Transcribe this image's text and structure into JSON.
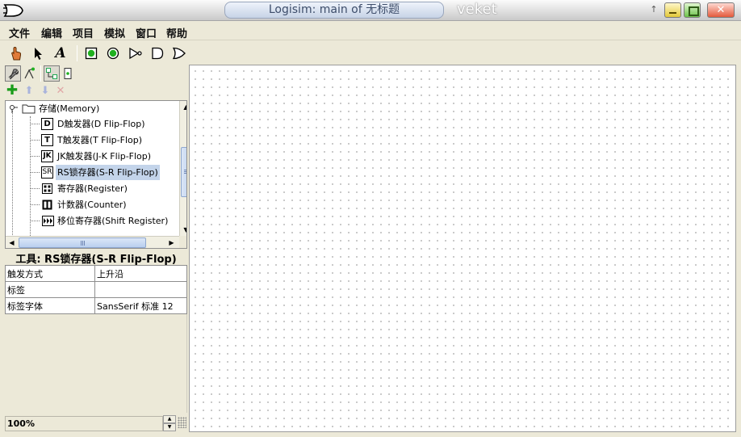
{
  "window": {
    "title": "Logisim: main of 无标题",
    "brand": "veket"
  },
  "menu": [
    "文件",
    "编辑",
    "项目",
    "模拟",
    "窗口",
    "帮助"
  ],
  "tree": {
    "folder_label": "存储(Memory)",
    "items": [
      {
        "icon_text": "D",
        "label": "D触发器(D Flip-Flop)",
        "icon": "d-flipflop-icon"
      },
      {
        "icon_text": "T",
        "label": "T触发器(T Flip-Flop)",
        "icon": "t-flipflop-icon"
      },
      {
        "icon_text": "JK",
        "label": "JK触发器(J-K Flip-Flop)",
        "icon": "jk-flipflop-icon"
      },
      {
        "icon_text": "SR",
        "label": "RS锁存器(S-R Flip-Flop)",
        "icon": "sr-flipflop-icon",
        "selected": true
      },
      {
        "icon_text": "",
        "label": "寄存器(Register)",
        "icon": "register-icon"
      },
      {
        "icon_text": "",
        "label": "计数器(Counter)",
        "icon": "counter-icon"
      },
      {
        "icon_text": "",
        "label": "移位寄存器(Shift Register)",
        "icon": "shift-register-icon"
      }
    ]
  },
  "tool_title": "工具: RS锁存器(S-R Flip-Flop)",
  "properties": [
    {
      "key": "触发方式",
      "value": "上升沿"
    },
    {
      "key": "标签",
      "value": ""
    },
    {
      "key": "标签字体",
      "value": "SansSerif 标准 12"
    }
  ],
  "zoom": "100%",
  "colors": {
    "selection": "#c3d4ea",
    "add_icon": "#1a9c1a",
    "pin_green": "#20b020"
  }
}
